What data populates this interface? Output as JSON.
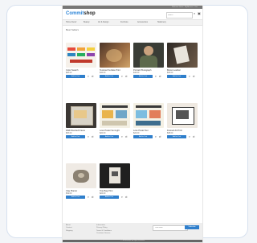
{
  "topbar": {
    "text": "Welcome Guest · My Account · Cart"
  },
  "logo": {
    "part1": "Commit",
    "part2": "shop"
  },
  "search": {
    "placeholder": "Search"
  },
  "nav": {
    "items": [
      "Home Decor",
      "Beauty",
      "Art & Design",
      "Furniture",
      "Accessories",
      "Stationery"
    ]
  },
  "page": {
    "title": "Best Sellers"
  },
  "products": [
    {
      "name": "Color Swatch",
      "price": "$28.00",
      "button": "Add to Cart"
    },
    {
      "name": "Textured Surface Print",
      "price": "$34.00",
      "button": "Add to Cart"
    },
    {
      "name": "Portrait Photograph",
      "price": "$42.00",
      "button": "Add to Cart"
    },
    {
      "name": "Brown Leather",
      "price": "$30.00",
      "button": "Add to Cart"
    },
    {
      "name": "Wall Mounted Frame",
      "price": "$25.00",
      "button": "Add to Cart"
    },
    {
      "name": "Love Poster Set Light",
      "price": "$22.00",
      "button": "Add to Cart"
    },
    {
      "name": "Love Poster Set",
      "price": "$22.00",
      "button": "Add to Cart"
    },
    {
      "name": "Framed Art Print",
      "price": "$38.00",
      "button": "Add to Cart"
    },
    {
      "name": "Clay Planter",
      "price": "$19.00",
      "button": "Add to Cart"
    },
    {
      "name": "Tote Bag Print",
      "price": "$24.00",
      "button": "Add to Cart"
    }
  ],
  "footer": {
    "col1": [
      "About",
      "Contact",
      "Shipping"
    ],
    "col2": [
      "Information",
      "Privacy Policy",
      "Terms & Conditions",
      "Customer Service"
    ],
    "newsletter_placeholder": "Your email",
    "newsletter_button": "Subscribe",
    "copyright": "© Commitshop. All rights reserved."
  }
}
